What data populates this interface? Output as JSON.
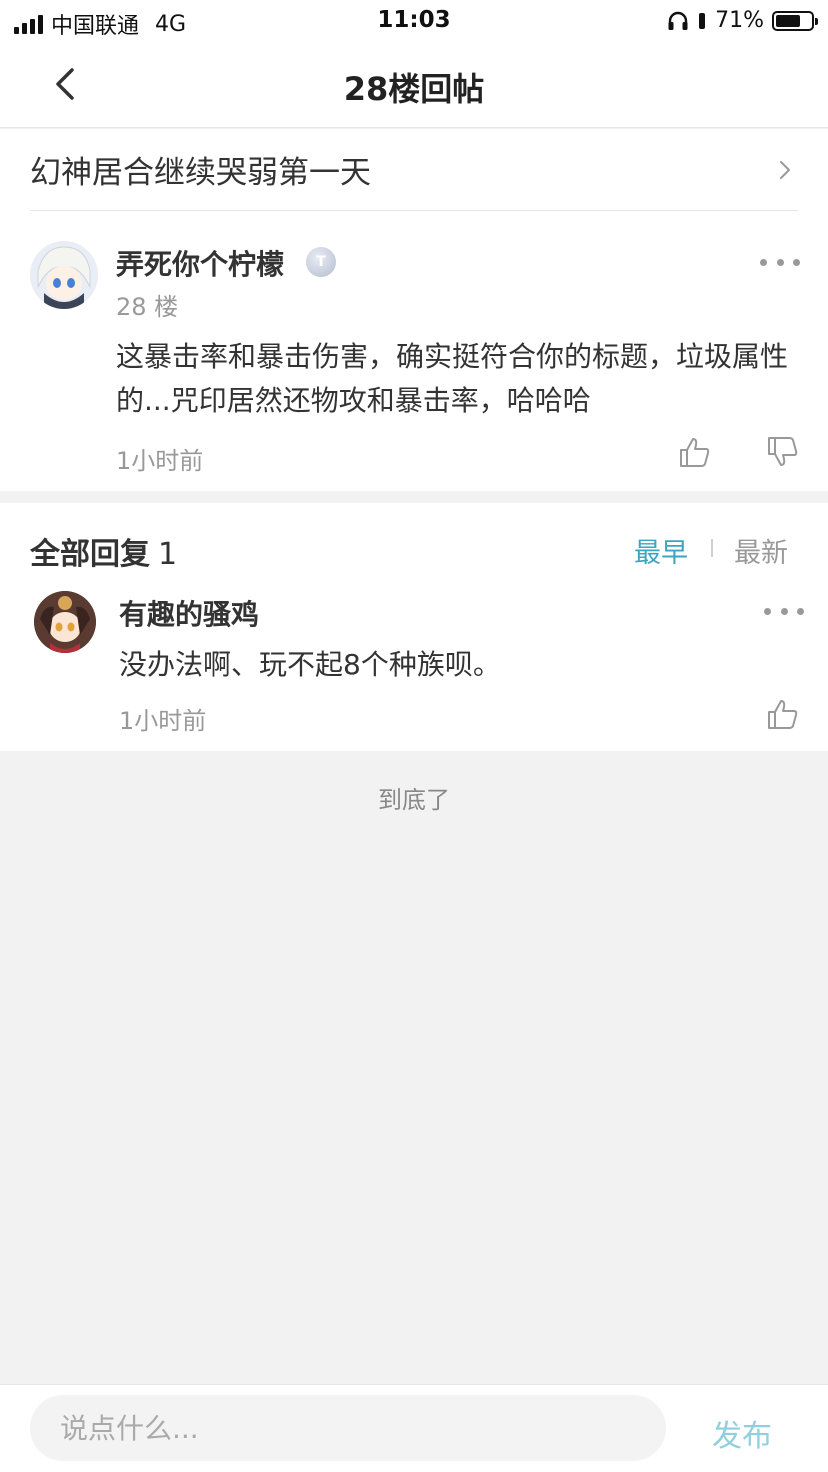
{
  "status_bar": {
    "carrier": "中国联通",
    "network": "4G",
    "time": "11:03",
    "battery_text": "71%",
    "battery_level": 0.71
  },
  "nav": {
    "title": "28楼回帖",
    "back_icon": "chevron-left-icon"
  },
  "thread": {
    "title": "幻神居合继续哭弱第一天"
  },
  "post": {
    "username": "弄死你个柠檬",
    "level_badge": "T",
    "floor": "28 楼",
    "content": "这暴击率和暴击伤害，确实挺符合你的标题，垃圾属性的...咒印居然还物攻和暴击率，哈哈哈",
    "time": "1小时前"
  },
  "replies": {
    "header": "全部回复",
    "count": "1",
    "sort_earliest": "最早",
    "sort_latest": "最新",
    "items": [
      {
        "username": "有趣的骚鸡",
        "content": "没办法啊、玩不起8个种族呗。",
        "time": "1小时前"
      }
    ],
    "end_note": "到底了"
  },
  "composer": {
    "placeholder": "说点什么...",
    "publish_label": "发布"
  },
  "colors": {
    "accent": "#3aa6c0",
    "publish_disabled": "#8fcfe0"
  }
}
